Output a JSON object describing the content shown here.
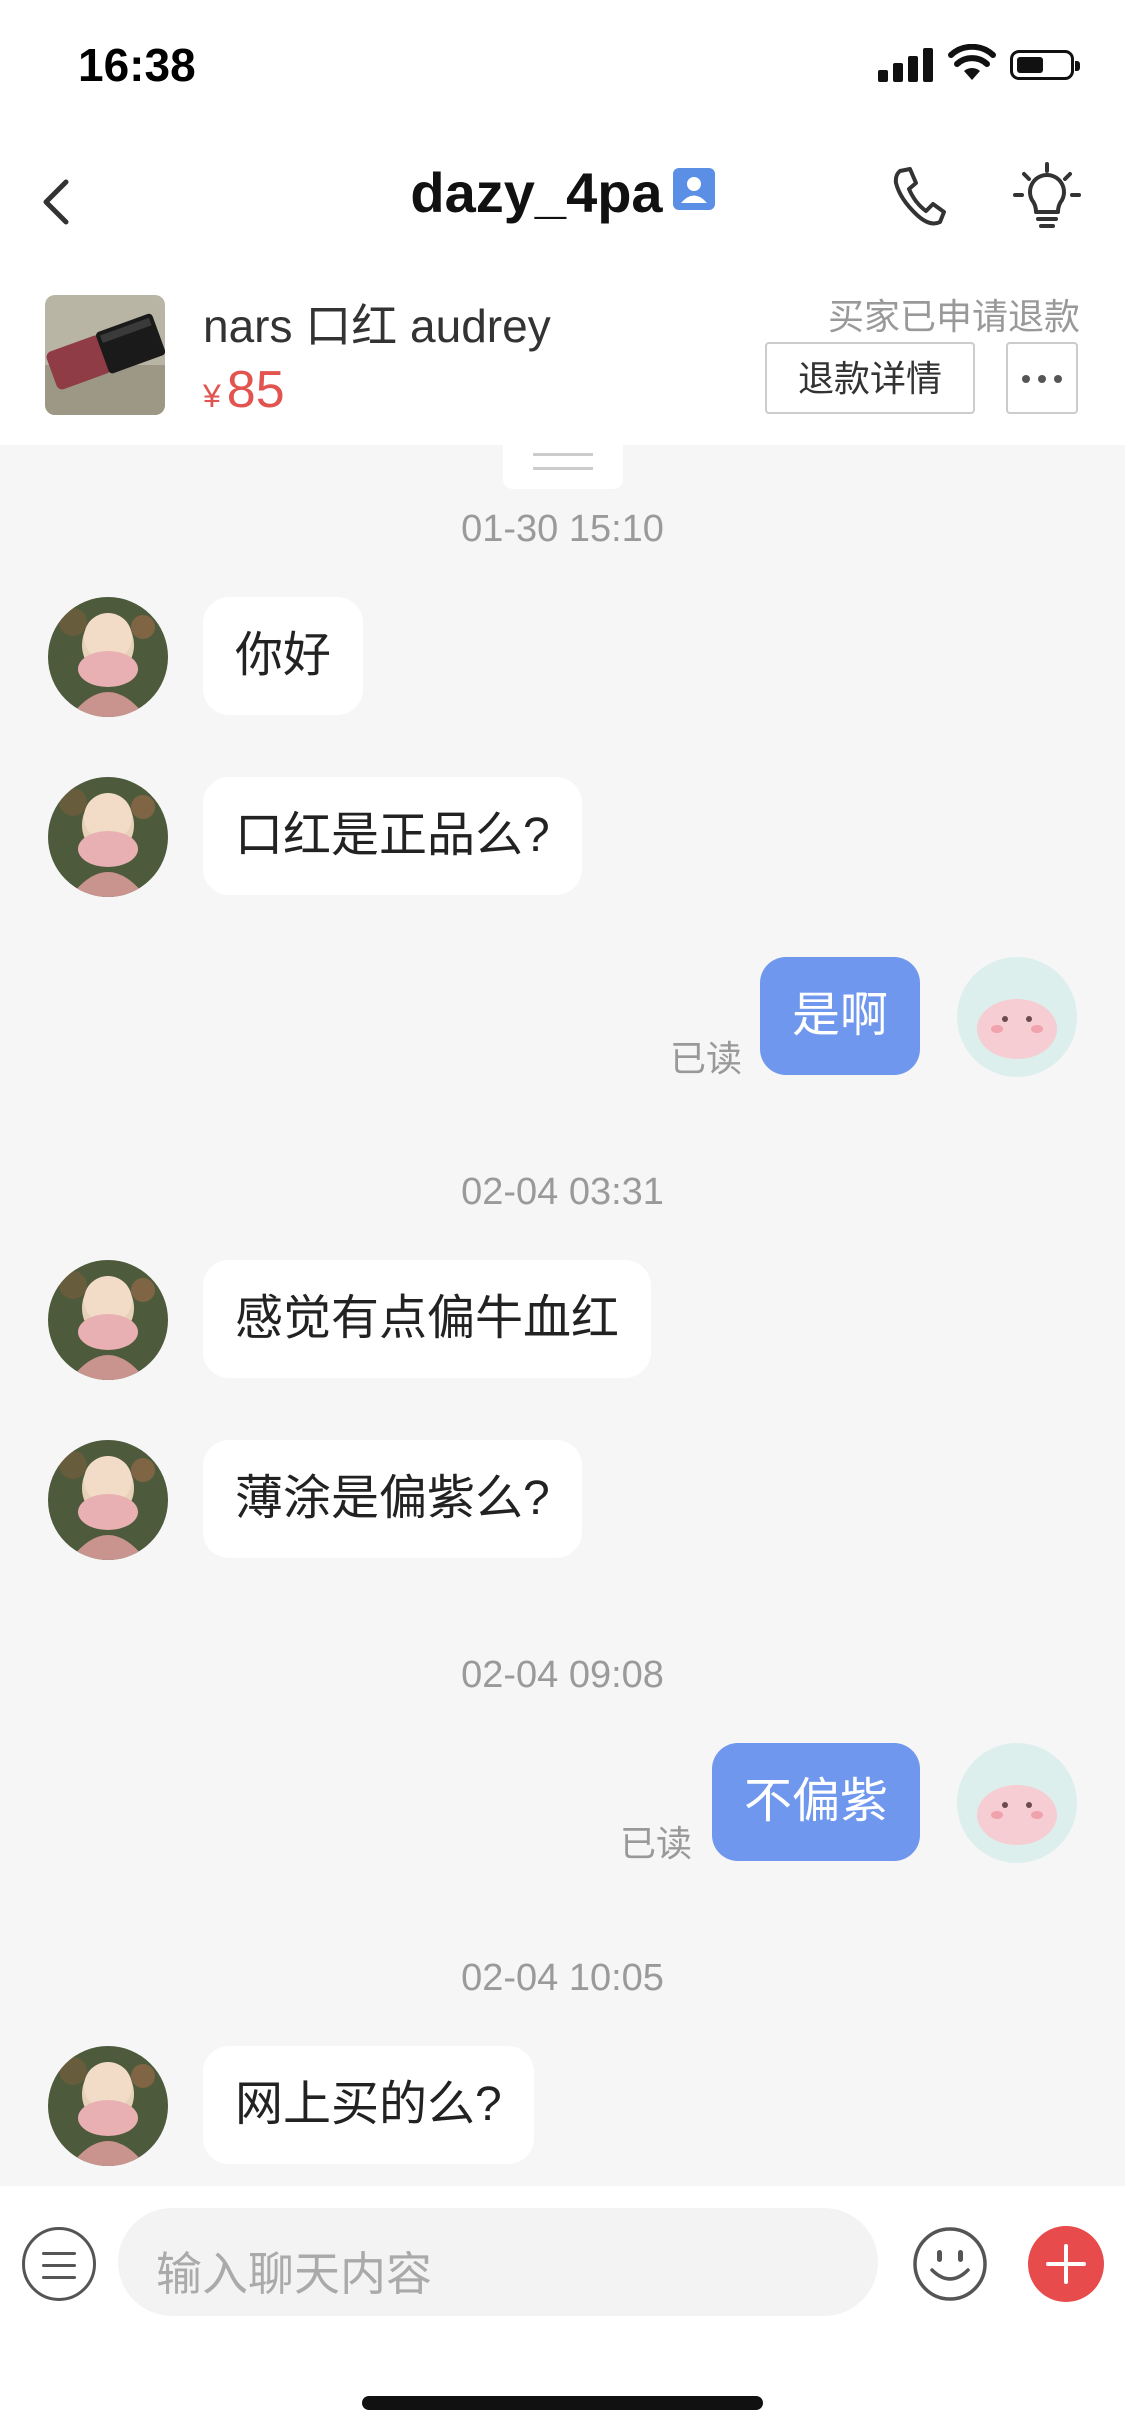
{
  "status_bar": {
    "time": "16:38"
  },
  "header": {
    "title": "dazy_4pa"
  },
  "product": {
    "name": "nars 口红 audrey",
    "currency_symbol": "¥",
    "price": "85",
    "refund_status": "买家已申请退款",
    "refund_button": "退款详情"
  },
  "messages": [
    {
      "type": "timestamp",
      "text": "01-30 15:10"
    },
    {
      "type": "incoming",
      "text": "你好"
    },
    {
      "type": "incoming",
      "text": "口红是正品么?"
    },
    {
      "type": "outgoing",
      "text": "是啊",
      "read_label": "已读"
    },
    {
      "type": "timestamp",
      "text": "02-04 03:31"
    },
    {
      "type": "incoming",
      "text": "感觉有点偏牛血红"
    },
    {
      "type": "incoming",
      "text": "薄涂是偏紫么?"
    },
    {
      "type": "timestamp",
      "text": "02-04 09:08"
    },
    {
      "type": "outgoing",
      "text": "不偏紫",
      "read_label": "已读"
    },
    {
      "type": "timestamp",
      "text": "02-04 10:05"
    },
    {
      "type": "incoming",
      "text": "网上买的么?"
    }
  ],
  "input": {
    "placeholder": "输入聊天内容"
  },
  "colors": {
    "accent": "#6f97ee",
    "price": "#e2544f",
    "plus_button": "#e84b4b"
  },
  "icons": [
    "back-icon",
    "verified-user-icon",
    "phone-icon",
    "lightbulb-icon",
    "more-icon",
    "menu-icon",
    "emoji-icon",
    "plus-icon"
  ]
}
